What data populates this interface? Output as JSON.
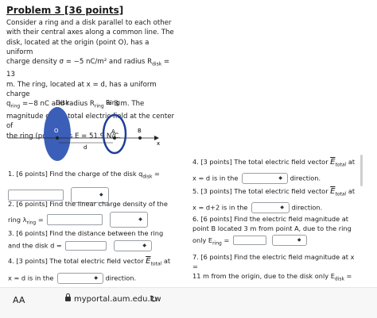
{
  "problem": {
    "title": "Problem 3 [36 points]",
    "line1": "Consider a ring and a disk parallel to each other",
    "line2": "with their central axes along a common line. The",
    "line3": "disk, located at the origin (point O), has a uniform",
    "line4": "charge density σ = −5 nC/m² and radius R",
    "line4_sub": "disk",
    "line4_end": " = 13",
    "line5": "m. The ring, located at x = d, has a uniform charge",
    "line6_pre": "q",
    "line6_sub": "ring",
    "line6_mid": " =−8 nC and radius R",
    "line6_sub2": "ring",
    "line6_end": " = 3 m. The",
    "line7": "magnitude of the total electric field at the center of",
    "line8": "the ring (point A) is E = 51.9 N/C."
  },
  "figure": {
    "disk_label": "Disk",
    "ring_label": "Ring",
    "o_label": "O",
    "a_label": "A",
    "b_label": "B",
    "x_label": "x",
    "d_label": "d",
    "disk_color": "#3b5fb8",
    "ring_color": "#1f3f99"
  },
  "questions": {
    "q1_label": "1. [6 points] Find the charge of the disk q",
    "q1_sub": "disk",
    "q1_end": " =",
    "q2_label_a": "2. [6 points] Find the linear charge density of the",
    "q2_label_b": "ring λ",
    "q2_sub": "ring",
    "q2_end": " =",
    "q3_label_a": "3. [6 points] Find the distance between the ring",
    "q3_label_b": "and the disk d =",
    "q4_label": "4. [3 points] The total electric field vector ",
    "q4_vec": "E",
    "q4_vec_sub": "total",
    "q4_at": " at",
    "q4_line2_a": "x = d is in the",
    "q4_line2_b": "direction.",
    "r4_label": "4. [3 points] The total electric field vector ",
    "r4_vec": "E",
    "r4_vec_sub": "total",
    "r4_at": " at",
    "r4_line2_a": "x = d is in the",
    "r4_line2_b": "direction.",
    "q5_label": "5. [3 points] The total electric field vector ",
    "q5_vec": "E",
    "q5_vec_sub": "total",
    "q5_at": " at",
    "q5_line2_a": "x = d+2  is in the",
    "q5_line2_b": "direction.",
    "q6_a": "6. [6 points] Find the electric field magnitude at",
    "q6_b": "point B located 3 m from point A, due to the ring",
    "q6_c": "only E",
    "q6_sub": "ring",
    "q6_end": " =",
    "q7_a": "7. [6 points] Find the electric field magnitude at x =",
    "q7_b": "11 m from the origin, due to the disk only E",
    "q7_sub": "disk",
    "q7_end": " ="
  },
  "browser": {
    "aa_label": "AA",
    "url": "myportal.aum.edu.kw",
    "reload_icon": "reload-icon"
  }
}
